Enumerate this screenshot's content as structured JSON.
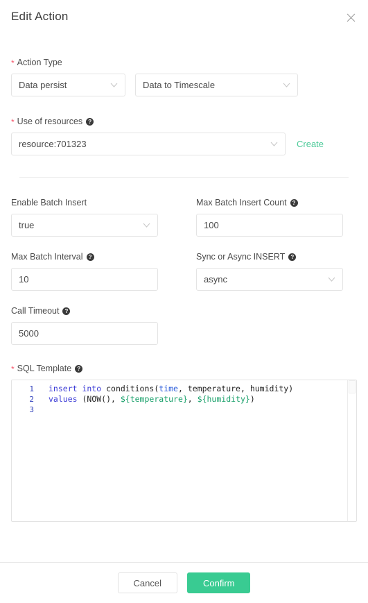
{
  "dialog": {
    "title": "Edit Action",
    "close_icon": "close-icon"
  },
  "action_type": {
    "label": "Action Type",
    "required": true,
    "primary_select": {
      "value": "Data persist",
      "icon": "chevron-down-icon"
    },
    "secondary_select": {
      "value": "Data to Timescale",
      "icon": "chevron-down-icon"
    }
  },
  "resources": {
    "label": "Use of resources",
    "required": true,
    "help_icon": "question-mark-icon",
    "select": {
      "value": "resource:701323",
      "icon": "chevron-down-icon"
    },
    "create_label": "Create"
  },
  "settings": {
    "enable_batch_insert": {
      "label": "Enable Batch Insert",
      "has_help": false,
      "value": "true",
      "type": "select",
      "icon": "chevron-down-icon"
    },
    "max_batch_insert_count": {
      "label": "Max Batch Insert Count",
      "has_help": true,
      "help_icon": "question-mark-icon",
      "value": "100",
      "type": "input"
    },
    "max_batch_interval": {
      "label": "Max Batch Interval",
      "has_help": true,
      "help_icon": "question-mark-icon",
      "value": "10",
      "type": "input"
    },
    "sync_or_async_insert": {
      "label": "Sync or Async INSERT",
      "has_help": true,
      "help_icon": "question-mark-icon",
      "value": "async",
      "type": "select",
      "icon": "chevron-down-icon"
    },
    "call_timeout": {
      "label": "Call Timeout",
      "has_help": true,
      "help_icon": "question-mark-icon",
      "value": "5000",
      "type": "input"
    }
  },
  "sql_template": {
    "label": "SQL Template",
    "required": true,
    "help_icon": "question-mark-icon",
    "line_numbers": [
      "1",
      "2",
      "3"
    ],
    "lines": [
      {
        "number": "1",
        "tokens": [
          {
            "text": "insert into",
            "kind": "keyword"
          },
          {
            "text": " conditions(",
            "kind": "plain"
          },
          {
            "text": "time",
            "kind": "type"
          },
          {
            "text": ", temperature, humidity)",
            "kind": "plain"
          }
        ]
      },
      {
        "number": "2",
        "tokens": [
          {
            "text": "values",
            "kind": "keyword"
          },
          {
            "text": " (NOW(), ",
            "kind": "plain"
          },
          {
            "text": "${temperature}",
            "kind": "variable"
          },
          {
            "text": ", ",
            "kind": "plain"
          },
          {
            "text": "${humidity}",
            "kind": "variable"
          },
          {
            "text": ")",
            "kind": "plain"
          }
        ]
      },
      {
        "number": "3",
        "tokens": []
      }
    ],
    "raw_text": "insert into conditions(time, temperature, humidity)\nvalues (NOW(), ${temperature}, ${humidity})\n"
  },
  "footer": {
    "cancel_label": "Cancel",
    "confirm_label": "Confirm"
  },
  "colors": {
    "accent_green": "#39cb92",
    "link_green": "#4ecb9a",
    "required_star": "#f5576c",
    "keyword_blue": "#3b3bd6",
    "type_blue": "#2a5cdb",
    "variable_green": "#18a06a",
    "gutter_blue": "#2f3fbb",
    "border": "#e4e4e4",
    "text": "#4a4a4a"
  }
}
